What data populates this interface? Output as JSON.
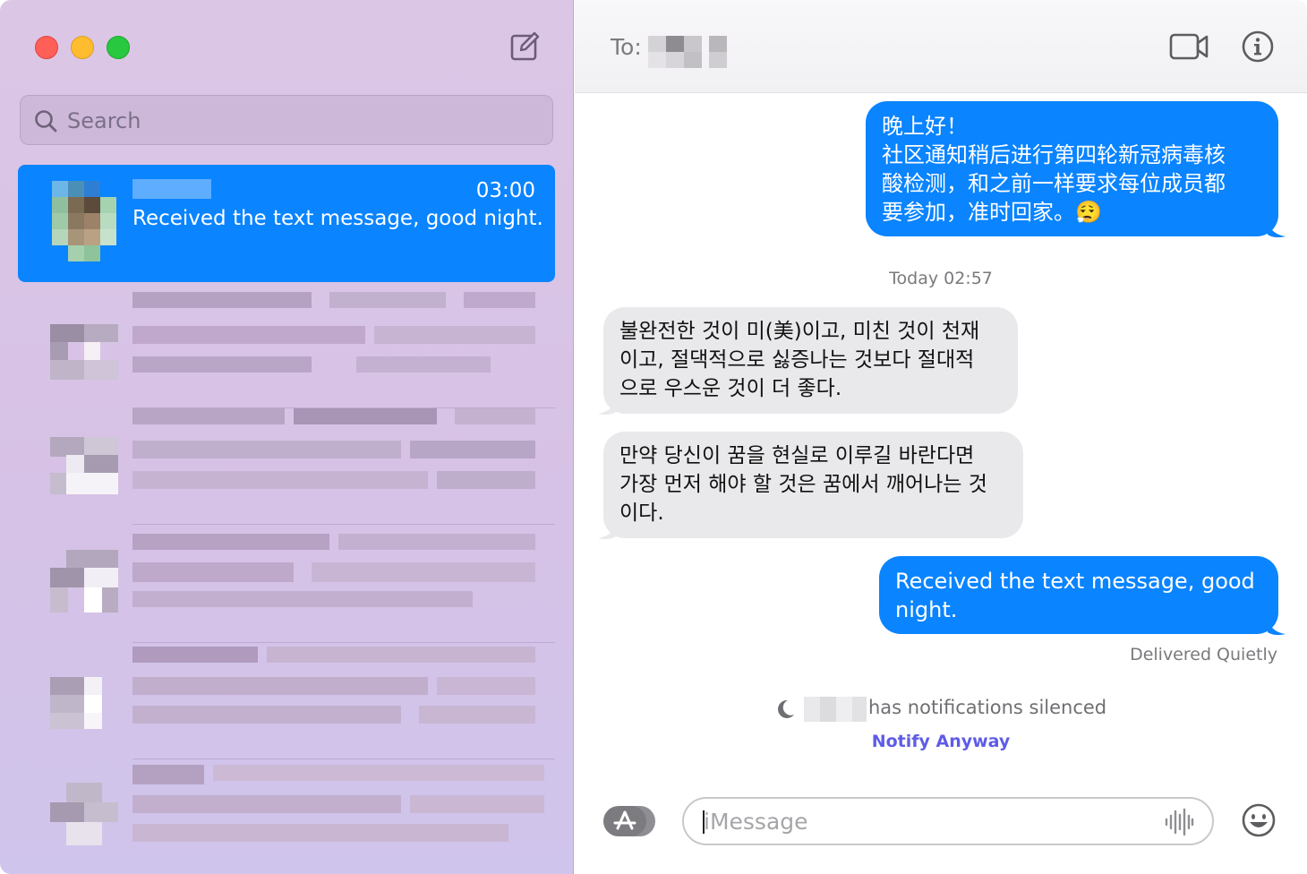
{
  "sidebar": {
    "search_placeholder": "Search",
    "selected_conversation": {
      "time": "03:00",
      "preview": "Received the text message, good night."
    }
  },
  "chat": {
    "to_label": "To:",
    "messages": [
      {
        "direction": "outgoing",
        "lines": [
          "晚上好！",
          "社区通知稍后进行第四轮新冠病毒核",
          "酸检测，和之前一样要求每位成员都",
          "要参加，准时回家。😮‍💨"
        ]
      },
      {
        "direction": "incoming",
        "lines": [
          "불완전한 것이 미(美)이고, 미친 것이 천재",
          "이고, 절댁적으로 싫증나는 것보다 절대적",
          "으로 우스운 것이 더 좋다."
        ]
      },
      {
        "direction": "incoming",
        "lines": [
          "만약 당신이 꿈을 현실로 이루길 바란다면",
          "가장 먼저 해야 할 것은 꿈에서 깨어나는 것",
          "이다."
        ]
      },
      {
        "direction": "outgoing",
        "lines": [
          "Received the text message, good",
          "night."
        ]
      }
    ],
    "timestamp": "Today 02:57",
    "delivered_status": "Delivered Quietly",
    "silenced_text": "has notifications silenced",
    "notify_anyway": "Notify Anyway",
    "input_placeholder": "iMessage"
  },
  "icons": {
    "compose": "compose-icon",
    "search": "search-icon",
    "video": "video-camera-icon",
    "info": "info-icon",
    "moon": "moon-icon",
    "apps": "app-store-icon",
    "audio": "audio-waveform-icon",
    "emoji": "emoji-icon"
  },
  "colors": {
    "accent_blue": "#0a84ff",
    "incoming_bubble": "#e9e9eb",
    "notify_link": "#5e5ce6",
    "traffic_red": "#fe5f57",
    "traffic_yellow": "#febc2e",
    "traffic_green": "#28c840"
  }
}
